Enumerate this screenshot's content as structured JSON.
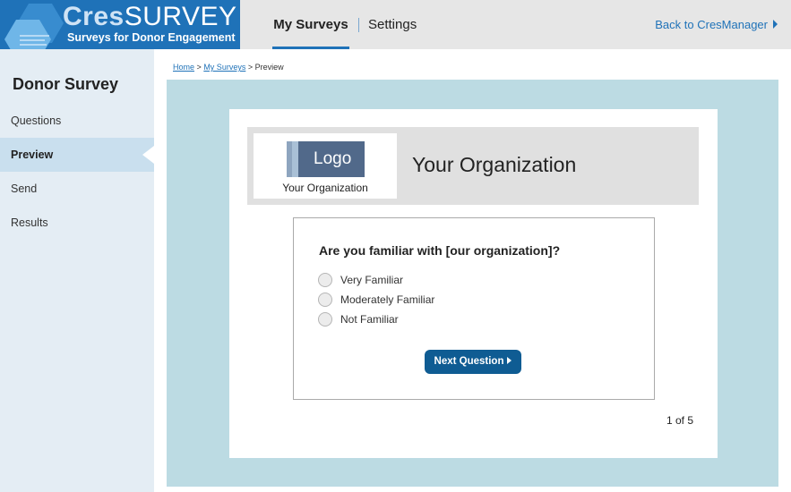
{
  "brand": {
    "name_part1": "Cres",
    "name_part2": "SURVEY",
    "tagline": "Surveys for Donor Engagement",
    "bg_color": "#1f72b8"
  },
  "nav": {
    "tabs": [
      {
        "label": "My Surveys",
        "active": true
      },
      {
        "label": "Settings",
        "active": false
      }
    ],
    "back_label": "Back to CresManager",
    "back_icon": "caret-right-icon"
  },
  "sidebar": {
    "title": "Donor Survey",
    "items": [
      {
        "label": "Questions",
        "active": false
      },
      {
        "label": "Preview",
        "active": true
      },
      {
        "label": "Send",
        "active": false
      },
      {
        "label": "Results",
        "active": false
      }
    ]
  },
  "breadcrumb": {
    "items": [
      "Home",
      "My Surveys",
      "Preview"
    ],
    "separator": ">"
  },
  "preview": {
    "logo_text": "Logo",
    "logo_caption": "Your Organization",
    "org_name": "Your Organization",
    "question": "Are you familiar with [our organization]?",
    "options": [
      "Very Familiar",
      "Moderately Familiar",
      "Not Familiar"
    ],
    "next_label": "Next Question",
    "page_indicator": "1 of 5",
    "accent_color": "#0f5c93",
    "area_bg_color": "#bcdbe3"
  }
}
